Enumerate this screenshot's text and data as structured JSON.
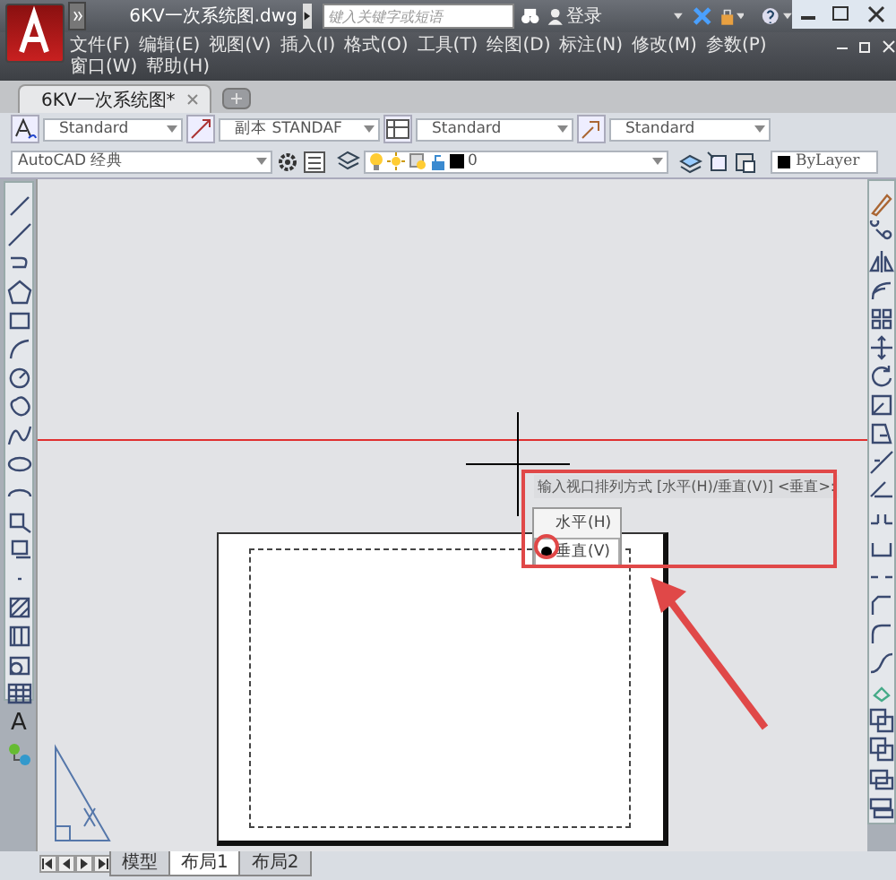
{
  "window": {
    "title": "6KV一次系统图.dwg",
    "search": {
      "placeholder": "键入关键字或短语"
    },
    "sign_in": "登录"
  },
  "menu_rows": [
    {
      "items": [
        "文件(F)",
        "编辑(E)",
        "视图(V)",
        "插入(I)",
        "格式(O)",
        "工具(T)",
        "绘图(D)",
        "标注(N)",
        "修改(M)",
        "参数(P)"
      ]
    },
    {
      "items": [
        "窗口(W)",
        "帮助(H)"
      ]
    }
  ],
  "doc_tabs": [
    {
      "label": "6KV一次系统图*",
      "selected": true
    }
  ],
  "style_toolbar": [
    {
      "value": "Standard"
    },
    {
      "value": "副本 STANDAF"
    },
    {
      "value": "Standard"
    },
    {
      "value": "Standard"
    }
  ],
  "workspace": "AutoCAD 经典",
  "layer": "0",
  "color_control": "ByLayer",
  "text_tool_glyph": "A",
  "command": {
    "prompt": "输入视口排列方式 [水平(H)/垂直(V)] <垂直>:",
    "options": [
      {
        "label": "水平(H)",
        "selected": false
      },
      {
        "label": "垂直(V)",
        "selected": true
      }
    ]
  },
  "layout_tabs": [
    {
      "label": "模型",
      "selected": false
    },
    {
      "label": "布局1",
      "selected": true
    },
    {
      "label": "布局2",
      "selected": false
    }
  ]
}
